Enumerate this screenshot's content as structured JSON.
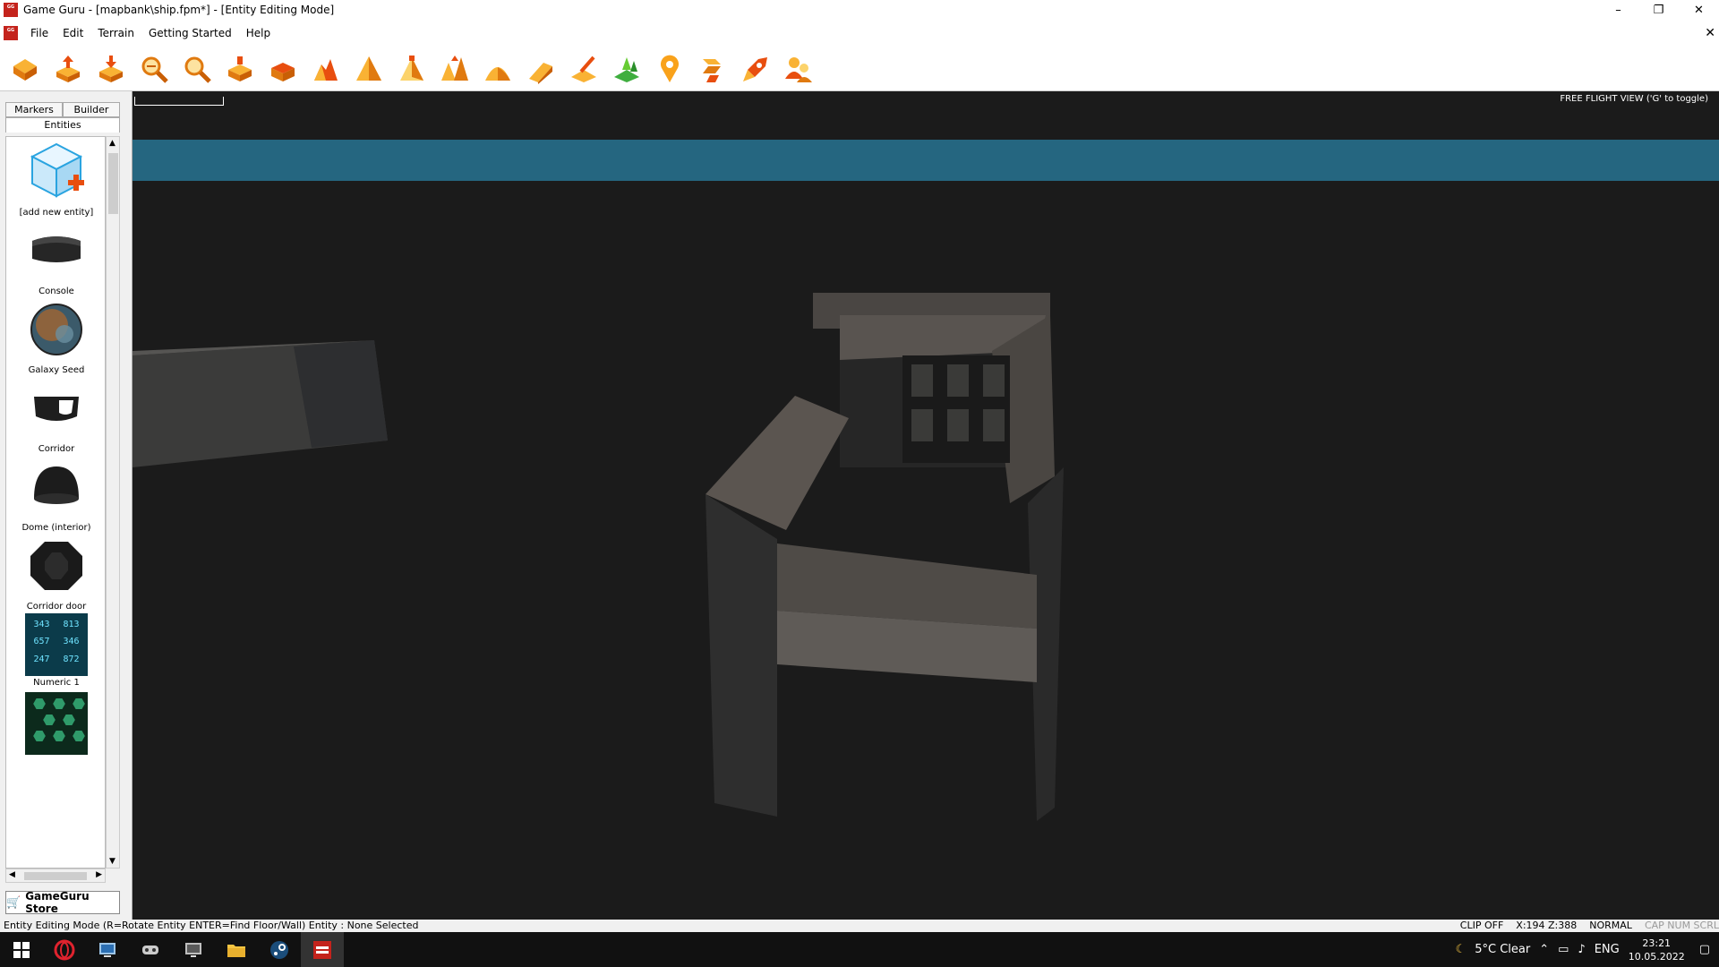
{
  "window": {
    "title": "Game Guru - [mapbank\\ship.fpm*] - [Entity Editing Mode]",
    "app_icon_text": "Game Guru"
  },
  "window_controls": {
    "minimize": "–",
    "maximize": "❐",
    "close": "✕",
    "doc_close": "✕"
  },
  "menu": {
    "items": [
      "File",
      "Edit",
      "Terrain",
      "Getting Started",
      "Help"
    ]
  },
  "toolbar": {
    "buttons": [
      "new-level-icon",
      "open-level-icon",
      "save-level-icon",
      "zoom-out-icon",
      "zoom-in-icon",
      "terrain-shape-icon",
      "terrain-level-icon",
      "terrain-raise-icon",
      "terrain-mountain-icon",
      "terrain-pyramid-icon",
      "terrain-peaks-icon",
      "terrain-blend-icon",
      "terrain-ramp-icon",
      "paint-brush-icon",
      "vegetation-icon",
      "waypoint-marker-icon",
      "test-level-icon",
      "publish-rocket-icon",
      "multiplayer-icon"
    ]
  },
  "left_panel": {
    "tabs": [
      "Markers",
      "Builder",
      "Entities"
    ],
    "entities": [
      {
        "label": "[add new entity]",
        "icon": "add-entity-icon"
      },
      {
        "label": "Console",
        "icon": "console-icon"
      },
      {
        "label": "Galaxy Seed",
        "icon": "galaxy-seed-icon"
      },
      {
        "label": "Corridor",
        "icon": "corridor-icon"
      },
      {
        "label": "Dome (interior)",
        "icon": "dome-icon"
      },
      {
        "label": "Corridor door",
        "icon": "corridor-door-icon"
      },
      {
        "label": "Numeric 1",
        "icon": "numeric-icon"
      },
      {
        "label": "",
        "icon": "hex-panel-icon"
      }
    ],
    "numeric_thumb_text": [
      "343",
      "813",
      "657",
      "346",
      "247",
      "872"
    ],
    "store_label": "GameGuru Store"
  },
  "viewport": {
    "view_mode_text": "FREE FLIGHT VIEW ('G' to toggle)",
    "sky_color": "#256680",
    "ground_color": "#1b1b1b"
  },
  "status": {
    "left": "Entity Editing Mode (R=Rotate Entity  ENTER=Find Floor/Wall)  Entity : None Selected",
    "clip": "CLIP OFF",
    "coords": "X:194  Z:388",
    "mode": "NORMAL",
    "keys": "CAP NUM SCRL"
  },
  "taskbar": {
    "apps": [
      "windows-start-icon",
      "opera-icon",
      "remote-desktop-icon",
      "gamepad-icon",
      "monitor-icon",
      "file-explorer-icon",
      "steam-icon",
      "game-guru-icon"
    ],
    "weather": "5°C  Clear",
    "language": "ENG",
    "time": "23:21",
    "date": "10.05.2022"
  }
}
